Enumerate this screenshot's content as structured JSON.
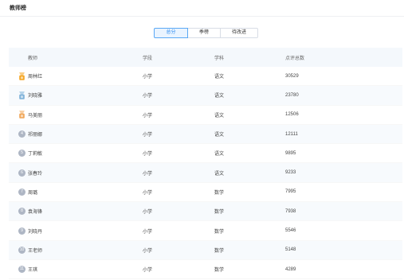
{
  "header": {
    "title": "教师榜"
  },
  "tabs": [
    {
      "label": "总分",
      "active": true
    },
    {
      "label": "季榜",
      "active": false
    },
    {
      "label": "待改进",
      "active": false
    }
  ],
  "table": {
    "columns": [
      "教师",
      "学段",
      "学科",
      "点评总数"
    ],
    "rows": [
      {
        "rank": "1",
        "badge": "gold",
        "teacher": "周林红",
        "school": "小学",
        "subject": "语文",
        "score": "30529"
      },
      {
        "rank": "2",
        "badge": "silver",
        "teacher": "刘晓雅",
        "school": "小学",
        "subject": "语文",
        "score": "23780"
      },
      {
        "rank": "3",
        "badge": "bronze",
        "teacher": "马美丽",
        "school": "小学",
        "subject": "语文",
        "score": "12506"
      },
      {
        "rank": "4",
        "badge": "circle",
        "teacher": "祁丽娜",
        "school": "小学",
        "subject": "语文",
        "score": "12111"
      },
      {
        "rank": "5",
        "badge": "circle",
        "teacher": "丁莉敏",
        "school": "小学",
        "subject": "语文",
        "score": "9895"
      },
      {
        "rank": "6",
        "badge": "circle",
        "teacher": "张春玲",
        "school": "小学",
        "subject": "语文",
        "score": "9233"
      },
      {
        "rank": "7",
        "badge": "circle",
        "teacher": "周璐",
        "school": "小学",
        "subject": "数学",
        "score": "7995"
      },
      {
        "rank": "8",
        "badge": "circle",
        "teacher": "袁海锋",
        "school": "小学",
        "subject": "数学",
        "score": "7938"
      },
      {
        "rank": "9",
        "badge": "circle",
        "teacher": "刘晓丹",
        "school": "小学",
        "subject": "数学",
        "score": "5546"
      },
      {
        "rank": "10",
        "badge": "circle",
        "teacher": "王老师",
        "school": "小学",
        "subject": "数学",
        "score": "5148"
      },
      {
        "rank": "11",
        "badge": "circle",
        "teacher": "王琪",
        "school": "小学",
        "subject": "数学",
        "score": "4289"
      }
    ]
  },
  "colors": {
    "accent": "#2d8cf0",
    "gold": "#f5a623",
    "silver": "#7fb2d9",
    "bronze": "#f0a75a",
    "circle": "#aeb6c4"
  }
}
